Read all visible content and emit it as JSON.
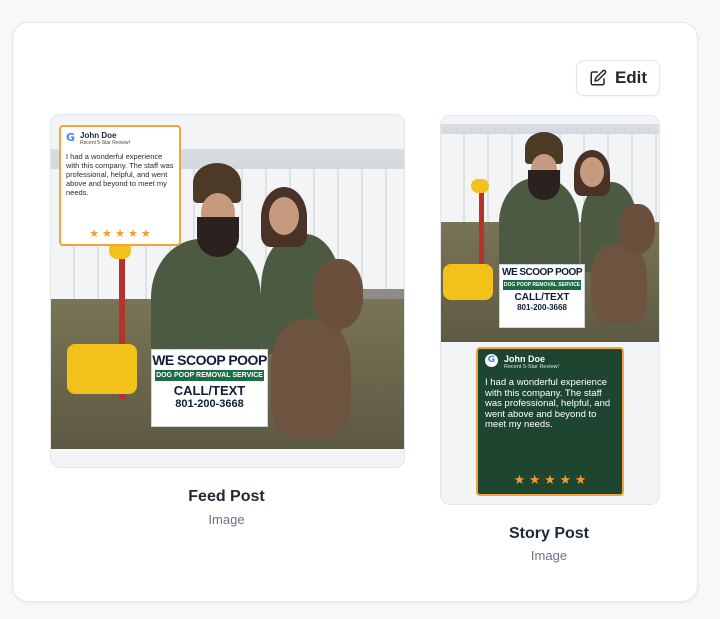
{
  "toolbar": {
    "edit_label": "Edit",
    "edit_icon": "pencil-square-icon"
  },
  "feed": {
    "title": "Feed Post",
    "type": "Image"
  },
  "story": {
    "title": "Story Post",
    "type": "Image"
  },
  "review": {
    "name": "John Doe",
    "subtitle": "Recent 5-Star Review!",
    "text": "I had a wonderful experience with this company. The staff was professional, helpful, and went above and beyond to meet my needs.",
    "stars": "★ ★ ★ ★ ★",
    "google_icon": "G"
  },
  "sign": {
    "line1": "WE SCOOP POOP",
    "line2": "DOG POOP REMOVAL SERVICE",
    "line3": "CALL/TEXT",
    "line4": "801-200-3668"
  },
  "colors": {
    "accent": "#f3a53c",
    "review_dark": "#1e4530",
    "star": "#f39c28"
  }
}
